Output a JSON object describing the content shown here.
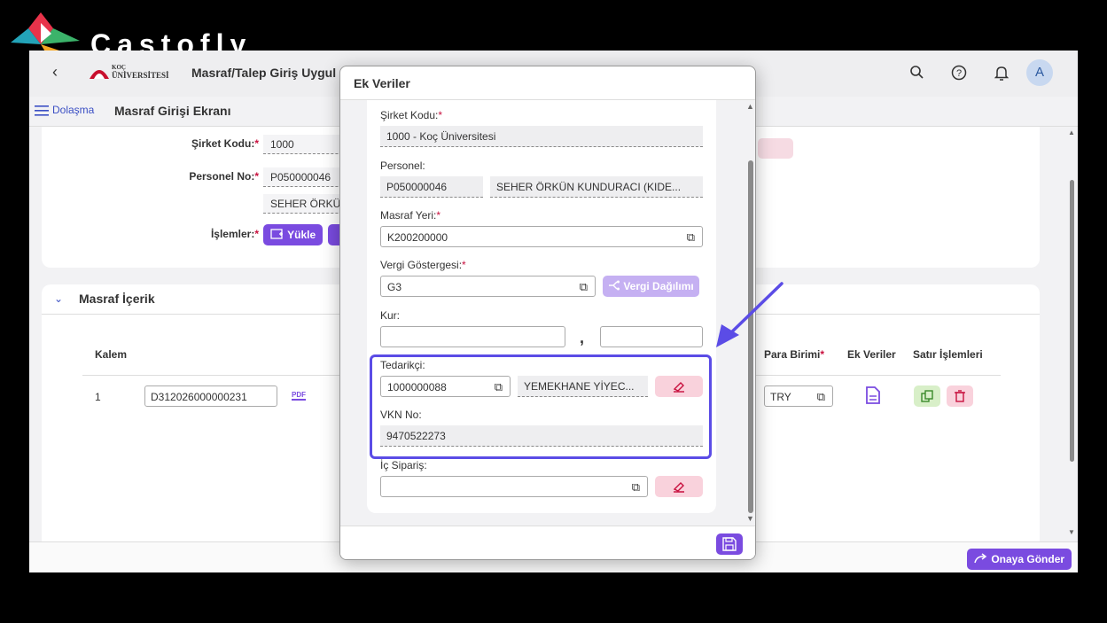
{
  "brand": {
    "name": "Castofly"
  },
  "header": {
    "university_line1": "KOÇ",
    "university_line2": "ÜNİVERSİTESİ",
    "app_title": "Masraf/Talep Giriş Uygul",
    "avatar_letter": "A"
  },
  "subheader": {
    "nav_label": "Dolaşma",
    "page_title": "Masraf Girişi Ekranı"
  },
  "form": {
    "company_label": "Şirket Kodu:",
    "company_value": "1000",
    "personnel_label": "Personel No:",
    "personnel_value": "P050000046",
    "personnel_name": "SEHER ÖRKÜ",
    "operations_label": "İşlemler:",
    "upload_label": "Yükle"
  },
  "expense_section": {
    "title": "Masraf İçerik",
    "headers": {
      "item": "Kalem",
      "currency": "Para Birimi",
      "extra": "Ek Veriler",
      "row_ops": "Satır İşlemleri"
    },
    "rows": [
      {
        "item": "1",
        "doc_no": "D312026000000231",
        "pdf": "PDF",
        "currency": "TRY"
      }
    ]
  },
  "footer": {
    "submit_label": "Onaya Gönder"
  },
  "modal": {
    "title": "Ek Veriler",
    "company_label": "Şirket Kodu:",
    "company_value": "1000 - Koç Üniversitesi",
    "personnel_label": "Personel:",
    "personnel_id": "P050000046",
    "personnel_name": "SEHER ÖRKÜN KUNDURACI (KIDE...",
    "cost_center_label": "Masraf Yeri:",
    "cost_center_value": "K200200000",
    "tax_label": "Vergi Göstergesi:",
    "tax_value": "G3",
    "tax_split_label": "Vergi Dağılımı",
    "rate_label": "Kur:",
    "rate_sep": ",",
    "supplier_label": "Tedarikçi:",
    "supplier_id": "1000000088",
    "supplier_name": "YEMEKHANE YİYEC...",
    "vkn_label": "VKN No:",
    "vkn_value": "9470522273",
    "internal_order_label": "İç Sipariş:"
  },
  "colors": {
    "accent": "#7a4be0",
    "highlight": "#5b4ce6",
    "required": "#c8103e"
  }
}
